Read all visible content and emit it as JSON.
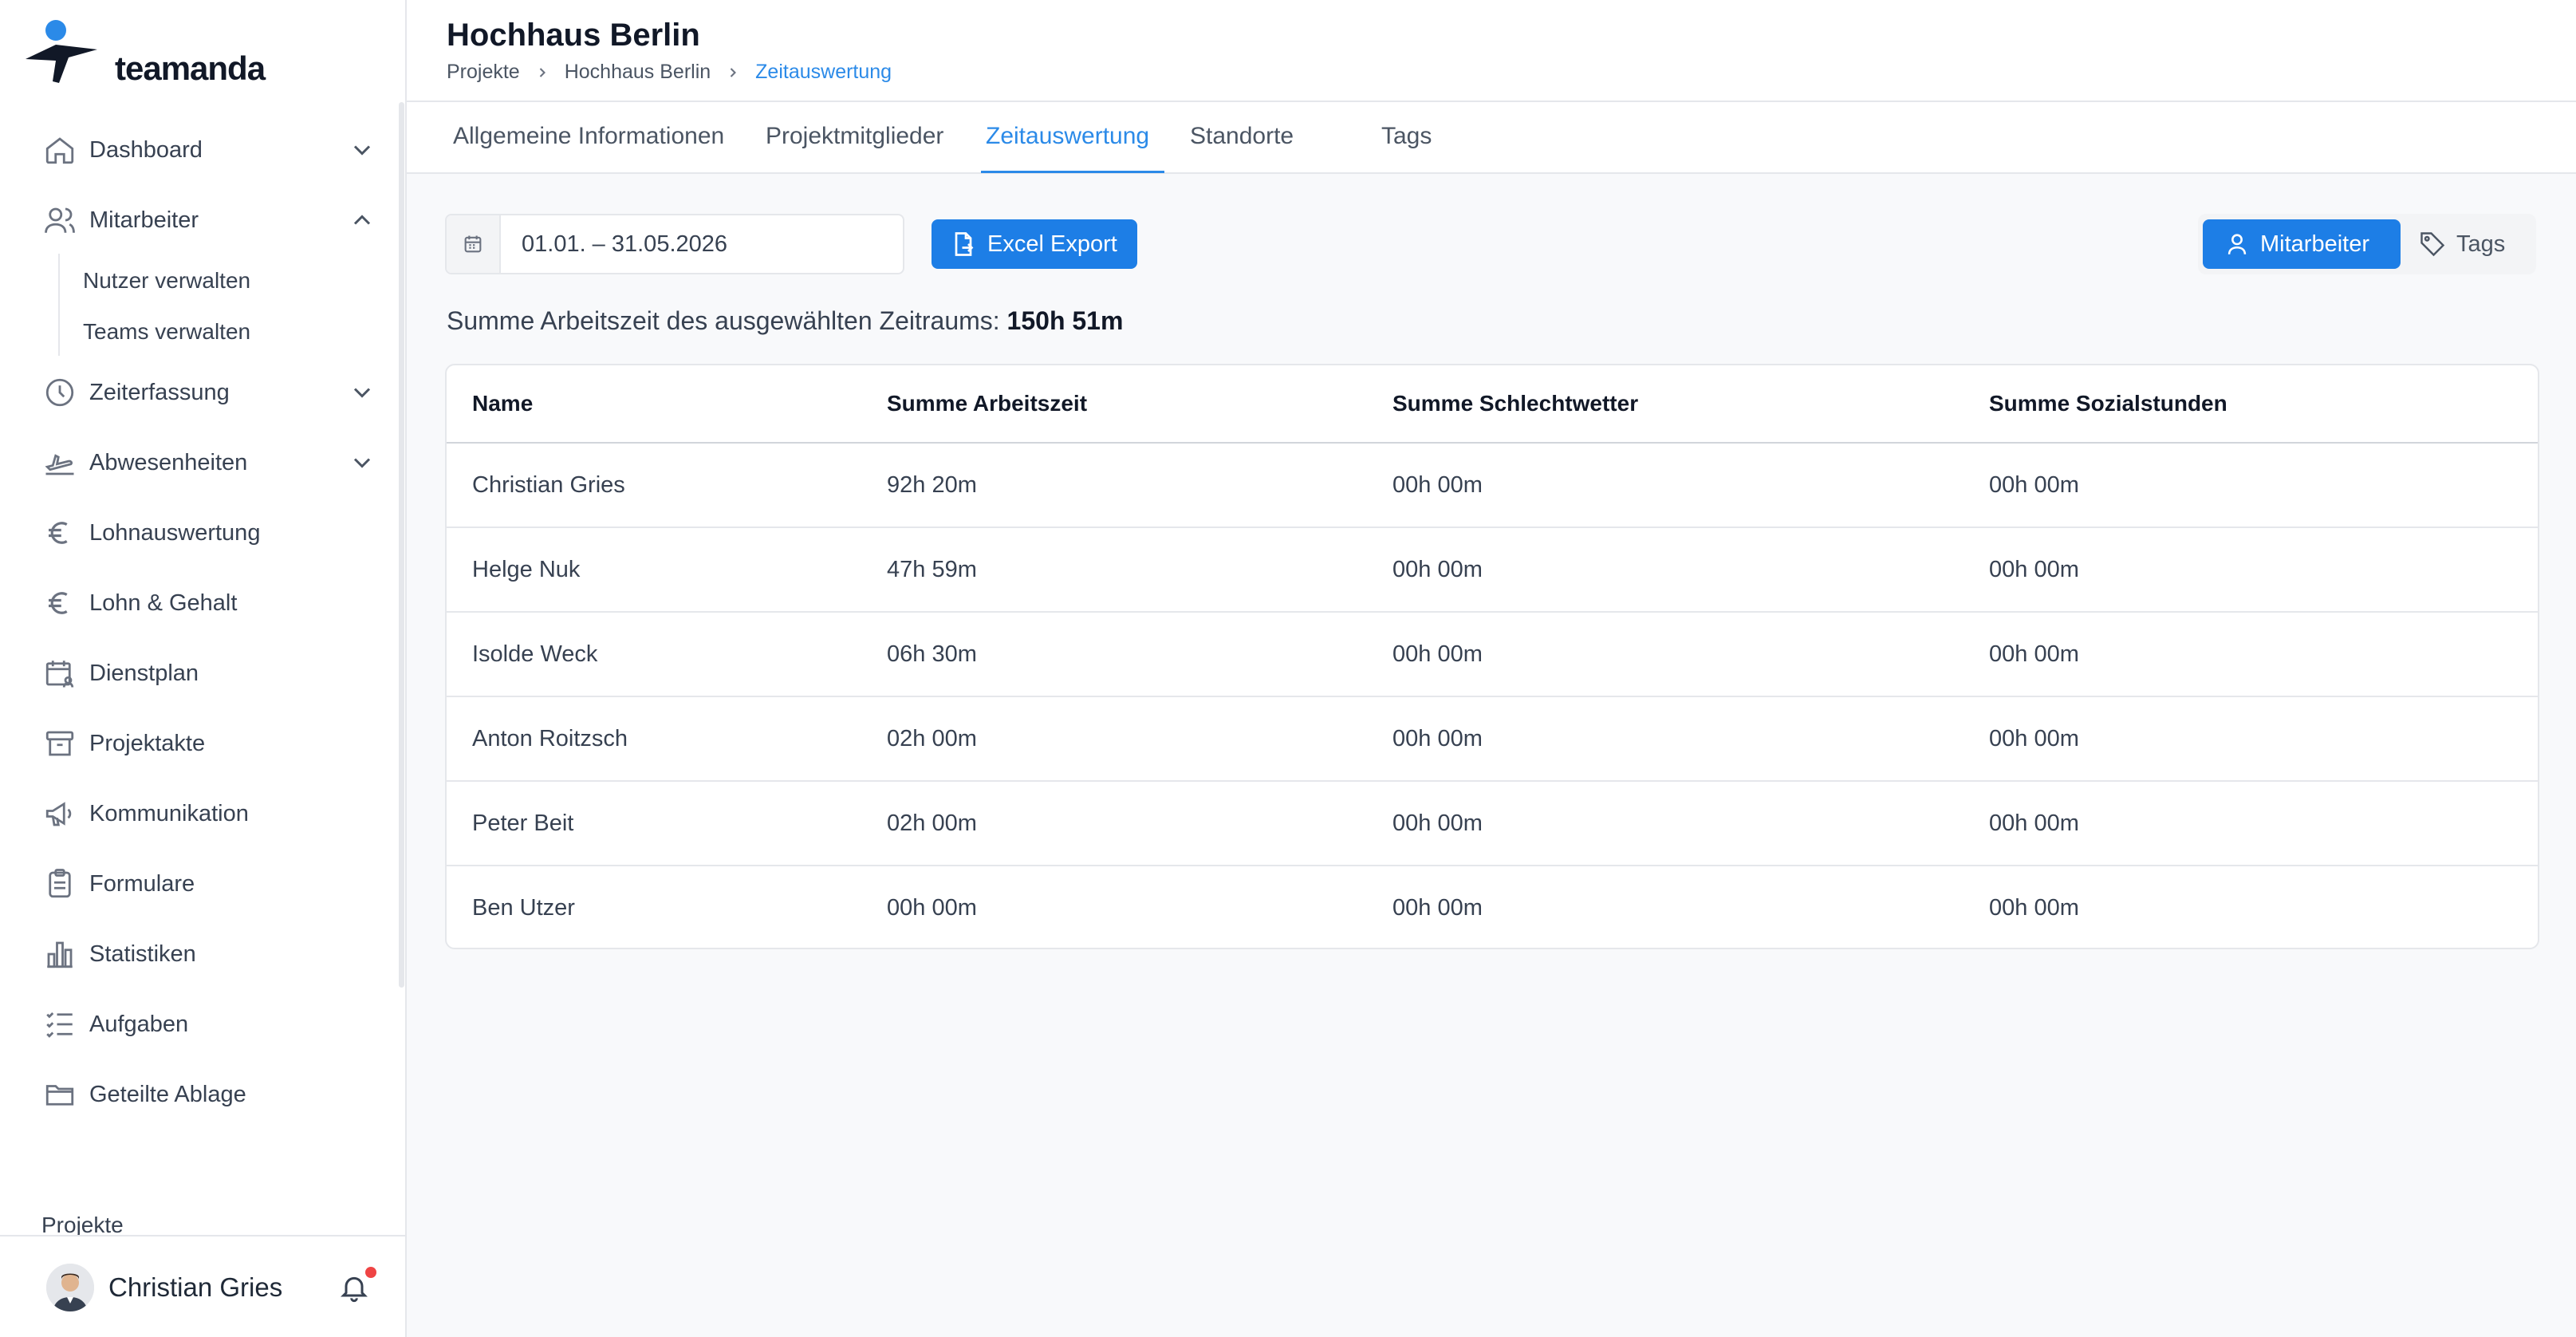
{
  "app": {
    "logo_text": "teamanda",
    "brand_color": "#1d7ee6"
  },
  "sidebar": {
    "items": [
      {
        "label": "Dashboard",
        "icon": "home-icon",
        "chevron": "down"
      },
      {
        "label": "Mitarbeiter",
        "icon": "users-icon",
        "chevron": "up"
      },
      {
        "label": "Zeiterfassung",
        "icon": "clock-icon",
        "chevron": "down"
      },
      {
        "label": "Abwesenheiten",
        "icon": "plane-icon",
        "chevron": "down"
      },
      {
        "label": "Lohnauswertung",
        "icon": "euro-icon"
      },
      {
        "label": "Lohn & Gehalt",
        "icon": "euro-icon"
      },
      {
        "label": "Dienstplan",
        "icon": "calendar-user-icon"
      },
      {
        "label": "Projektakte",
        "icon": "archive-icon"
      },
      {
        "label": "Kommunikation",
        "icon": "megaphone-icon"
      },
      {
        "label": "Formulare",
        "icon": "clipboard-icon"
      },
      {
        "label": "Statistiken",
        "icon": "bar-chart-icon"
      },
      {
        "label": "Aufgaben",
        "icon": "checklist-icon"
      },
      {
        "label": "Geteilte Ablage",
        "icon": "folder-icon"
      }
    ],
    "subitems": [
      "Nutzer verwalten",
      "Teams verwalten"
    ],
    "peek_label": "Projekte",
    "user": {
      "name": "Christian Gries"
    }
  },
  "header": {
    "title": "Hochhaus Berlin",
    "breadcrumb": [
      "Projekte",
      "Hochhaus Berlin",
      "Zeitauswertung"
    ]
  },
  "tabs": [
    "Allgemeine Informationen",
    "Projektmitglieder",
    "Zeitauswertung",
    "Standorte",
    "Tags"
  ],
  "active_tab": "Zeitauswertung",
  "toolbar": {
    "date_range": "01.01. – 31.05.2026",
    "export_label": "Excel Export",
    "view_employee_label": "Mitarbeiter",
    "view_tags_label": "Tags"
  },
  "summary": {
    "label": "Summe Arbeitszeit des ausgewählten Zeitraums:",
    "value": "150h 51m"
  },
  "table": {
    "headers": [
      "Name",
      "Summe Arbeitszeit",
      "Summe Schlechtwetter",
      "Summe Sozialstunden"
    ],
    "rows": [
      [
        "Christian Gries",
        "92h 20m",
        "00h 00m",
        "00h 00m"
      ],
      [
        "Helge Nuk",
        "47h 59m",
        "00h 00m",
        "00h 00m"
      ],
      [
        "Isolde Weck",
        "06h 30m",
        "00h 00m",
        "00h 00m"
      ],
      [
        "Anton Roitzsch",
        "02h 00m",
        "00h 00m",
        "00h 00m"
      ],
      [
        "Peter Beit",
        "02h 00m",
        "00h 00m",
        "00h 00m"
      ],
      [
        "Ben Utzer",
        "00h 00m",
        "00h 00m",
        "00h 00m"
      ]
    ]
  }
}
